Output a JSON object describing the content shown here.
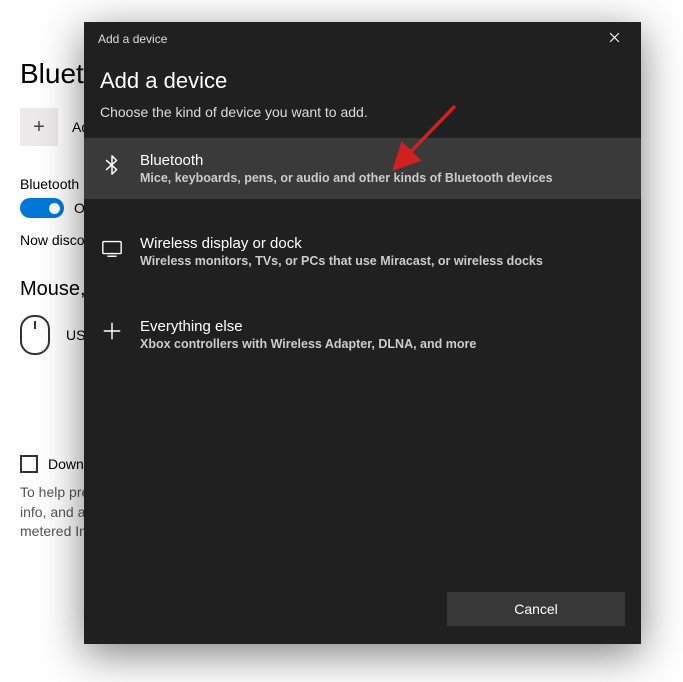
{
  "background": {
    "page_title": "Bluetooth",
    "add_label": "Ad",
    "bluetooth_label": "Bluetooth",
    "toggle_state_label": "O",
    "discoverable_text": "Now disco",
    "mouse_section_title": "Mouse,",
    "mouse_item": "US",
    "download_label": "Down",
    "help_text": "To help pre\ninfo, and a\nmetered In"
  },
  "dialog": {
    "titlebar": "Add a device",
    "heading": "Add a device",
    "subtitle": "Choose the kind of device you want to add.",
    "options": [
      {
        "title": "Bluetooth",
        "desc": "Mice, keyboards, pens, or audio and other kinds of Bluetooth devices"
      },
      {
        "title": "Wireless display or dock",
        "desc": "Wireless monitors, TVs, or PCs that use Miracast, or wireless docks"
      },
      {
        "title": "Everything else",
        "desc": "Xbox controllers with Wireless Adapter, DLNA, and more"
      }
    ],
    "cancel_label": "Cancel"
  }
}
